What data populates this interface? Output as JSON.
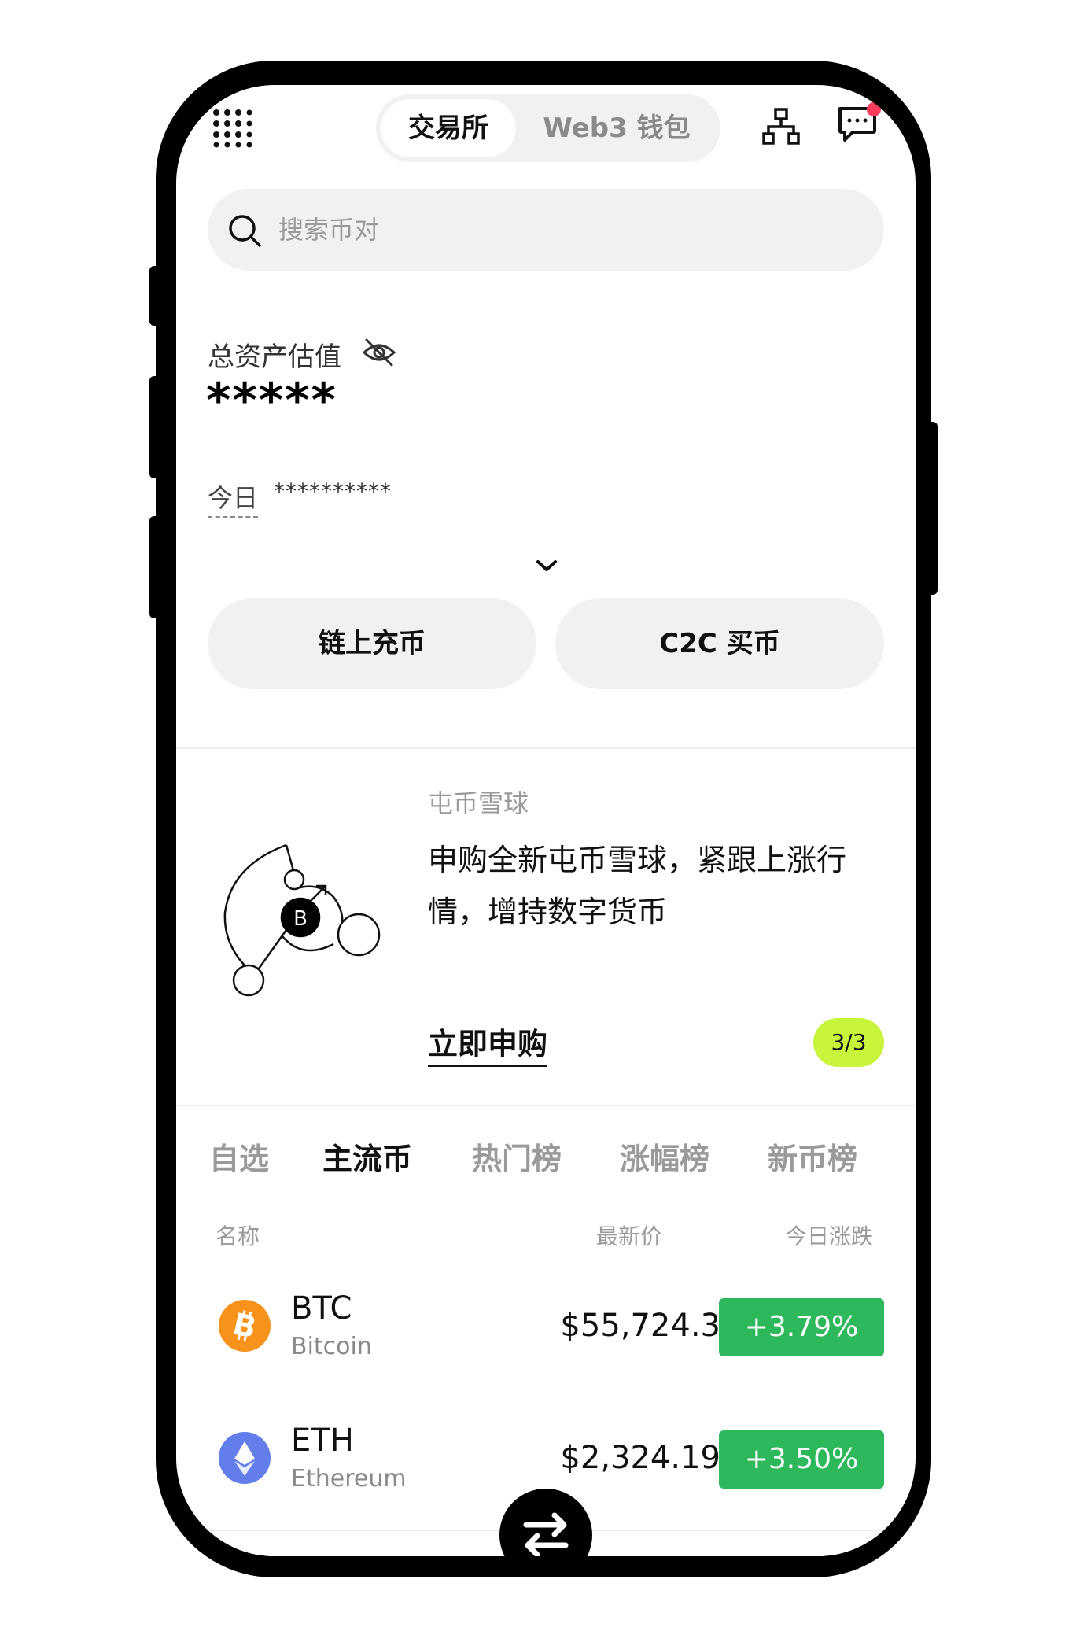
{
  "topbar": {
    "tab_exchange": "交易所",
    "tab_wallet": "Web3 钱包"
  },
  "search": {
    "placeholder": "搜索币对"
  },
  "assets": {
    "label": "总资产估值",
    "value": "*****",
    "today_label": "今日",
    "today_value": "**********"
  },
  "actions": {
    "deposit": "链上充币",
    "buy": "C2C 买币"
  },
  "promo": {
    "tag": "屯币雪球",
    "text": "申购全新屯币雪球，紧跟上涨行情，增持数字货币",
    "link": "立即申购",
    "page": "3/3"
  },
  "market_tabs": [
    "自选",
    "主流币",
    "热门榜",
    "涨幅榜",
    "新币榜"
  ],
  "table": {
    "col_name": "名称",
    "col_price": "最新价",
    "col_change": "今日涨跌"
  },
  "coins": [
    {
      "symbol": "BTC",
      "name": "Bitcoin",
      "price": "$55,724.3",
      "change": "+3.79%",
      "icon": "bitcoin-icon",
      "color": "#f7931a"
    },
    {
      "symbol": "ETH",
      "name": "Ethereum",
      "price": "$2,324.19",
      "change": "+3.50%",
      "icon": "ethereum-icon",
      "color": "#627eea"
    }
  ],
  "colors": {
    "accent_green": "#2eb85c",
    "badge_lime": "#c8f53c",
    "notification_red": "#ff3b5c"
  }
}
